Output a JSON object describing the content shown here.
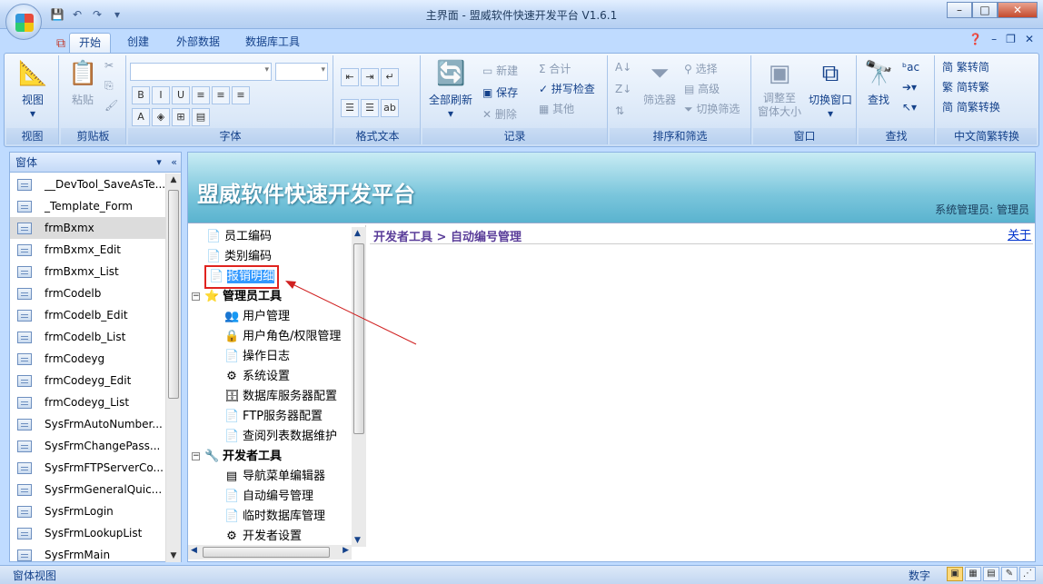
{
  "window": {
    "title": "主界面 - 盟威软件快速开发平台 V1.6.1"
  },
  "ribbon_tabs": [
    "开始",
    "创建",
    "外部数据",
    "数据库工具"
  ],
  "groups": {
    "view": {
      "label": "视图",
      "btn": "视图"
    },
    "clipboard": {
      "label": "剪贴板",
      "paste": "粘贴"
    },
    "font": {
      "label": "字体"
    },
    "richtext": {
      "label": "格式文本"
    },
    "records": {
      "label": "记录",
      "refresh": "全部刷新",
      "new": "新建",
      "save": "保存",
      "delete": "删除",
      "totals": "合计",
      "spell": "拼写检查",
      "more": "其他"
    },
    "sort": {
      "label": "排序和筛选",
      "filter": "筛选器",
      "selection": "选择",
      "advanced": "高级",
      "toggle": "切换筛选"
    },
    "window": {
      "label": "窗口",
      "fit": "调整至\n窗体大小",
      "switch": "切换窗口"
    },
    "find": {
      "label": "查找",
      "find": "查找"
    },
    "chinese": {
      "label": "中文简繁转换",
      "t2s": "繁转简",
      "s2t": "简转繁",
      "conv": "简繁转换"
    }
  },
  "left_panel": {
    "header": "窗体",
    "items": [
      "__DevTool_SaveAsTe...",
      "_Template_Form",
      "frmBxmx",
      "frmBxmx_Edit",
      "frmBxmx_List",
      "frmCodelb",
      "frmCodelb_Edit",
      "frmCodelb_List",
      "frmCodeyg",
      "frmCodeyg_Edit",
      "frmCodeyg_List",
      "SysFrmAutoNumber...",
      "SysFrmChangePass...",
      "SysFrmFTPServerCo...",
      "SysFrmGeneralQuic...",
      "SysFrmLogin",
      "SysFrmLookupList",
      "SysFrmMain"
    ],
    "selected_index": 2
  },
  "banner": {
    "title": "盟威软件快速开发平台",
    "user": "系统管理员: 管理员"
  },
  "tree": {
    "items": [
      "员工编码",
      "类别编码",
      "报销明细",
      "管理员工具",
      "用户管理",
      "用户角色/权限管理",
      "操作日志",
      "系统设置",
      "数据库服务器配置",
      "FTP服务器配置",
      "查阅列表数据维护",
      "开发者工具",
      "导航菜单编辑器",
      "自动编号管理",
      "临时数据库管理",
      "开发者设置"
    ]
  },
  "breadcrumb": "开发者工具 > 自动编号管理",
  "about": "关于",
  "status": {
    "left": "窗体视图",
    "right": "数字"
  }
}
